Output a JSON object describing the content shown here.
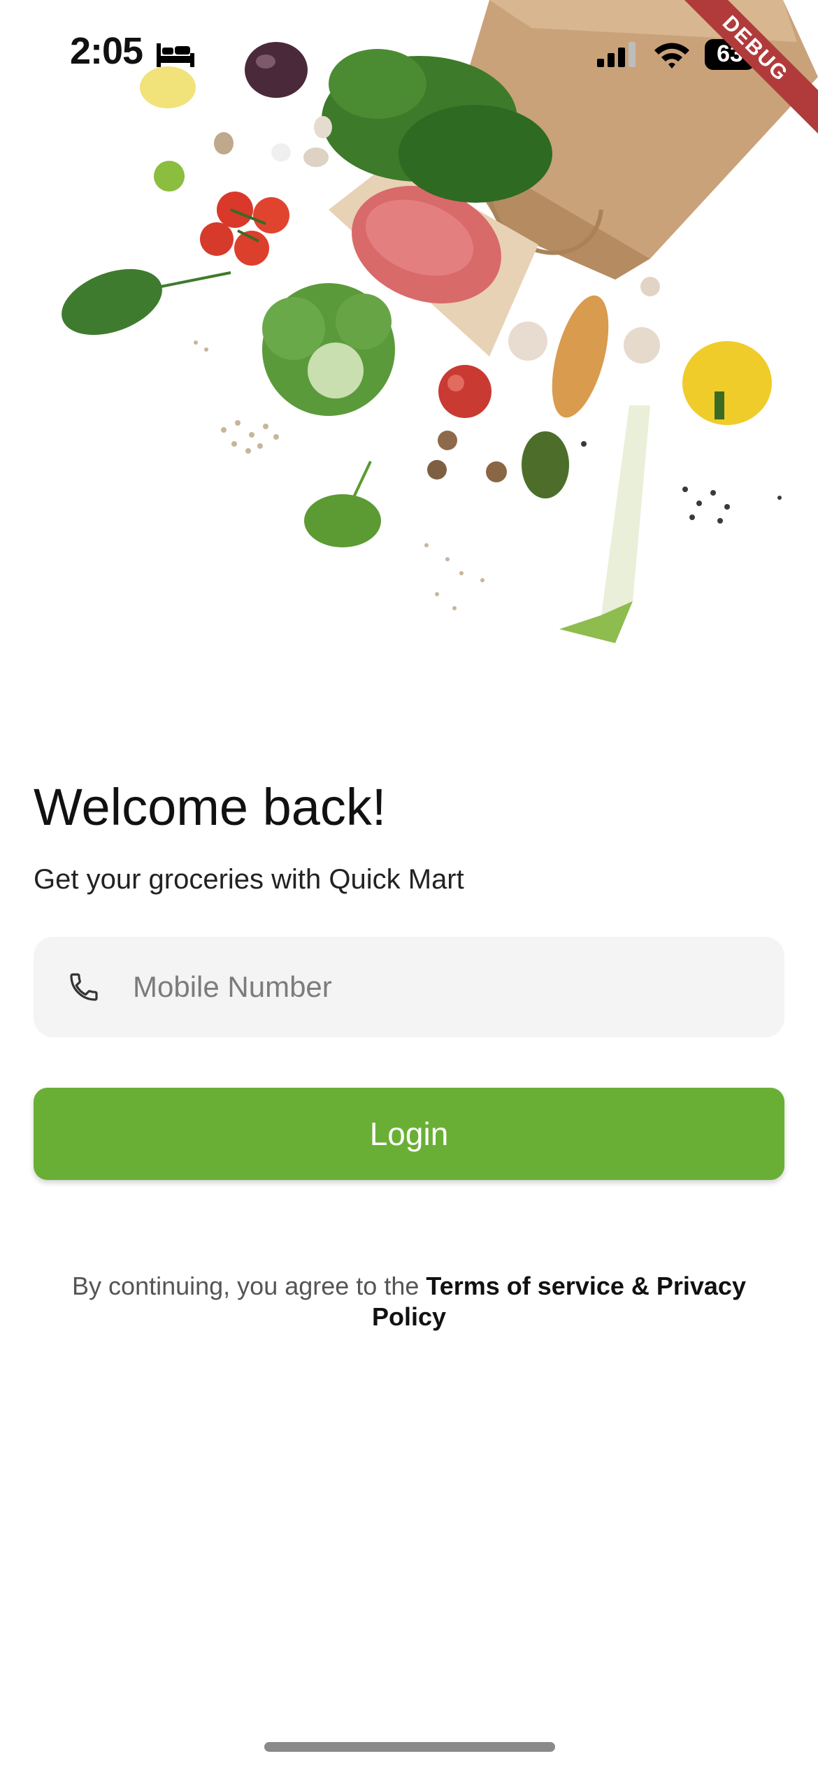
{
  "status_bar": {
    "time": "2:05",
    "battery": "63",
    "sleep_icon": "bed-icon",
    "signal_icon": "cellular-signal-icon",
    "wifi_icon": "wifi-icon",
    "battery_icon": "battery-icon"
  },
  "debug_banner": "DEBUG",
  "login": {
    "title": "Welcome back!",
    "subtitle": "Get your groceries with Quick Mart",
    "phone_icon": "phone-icon",
    "phone_placeholder": "Mobile Number",
    "phone_value": "",
    "login_button_label": "Login",
    "terms_prefix": "By continuing, you agree to the ",
    "terms_link": "Terms of service & Privacy Policy"
  },
  "colors": {
    "accent": "#6aaf35",
    "field_background": "#f4f4f4",
    "debug_ribbon": "#b13b3b"
  }
}
